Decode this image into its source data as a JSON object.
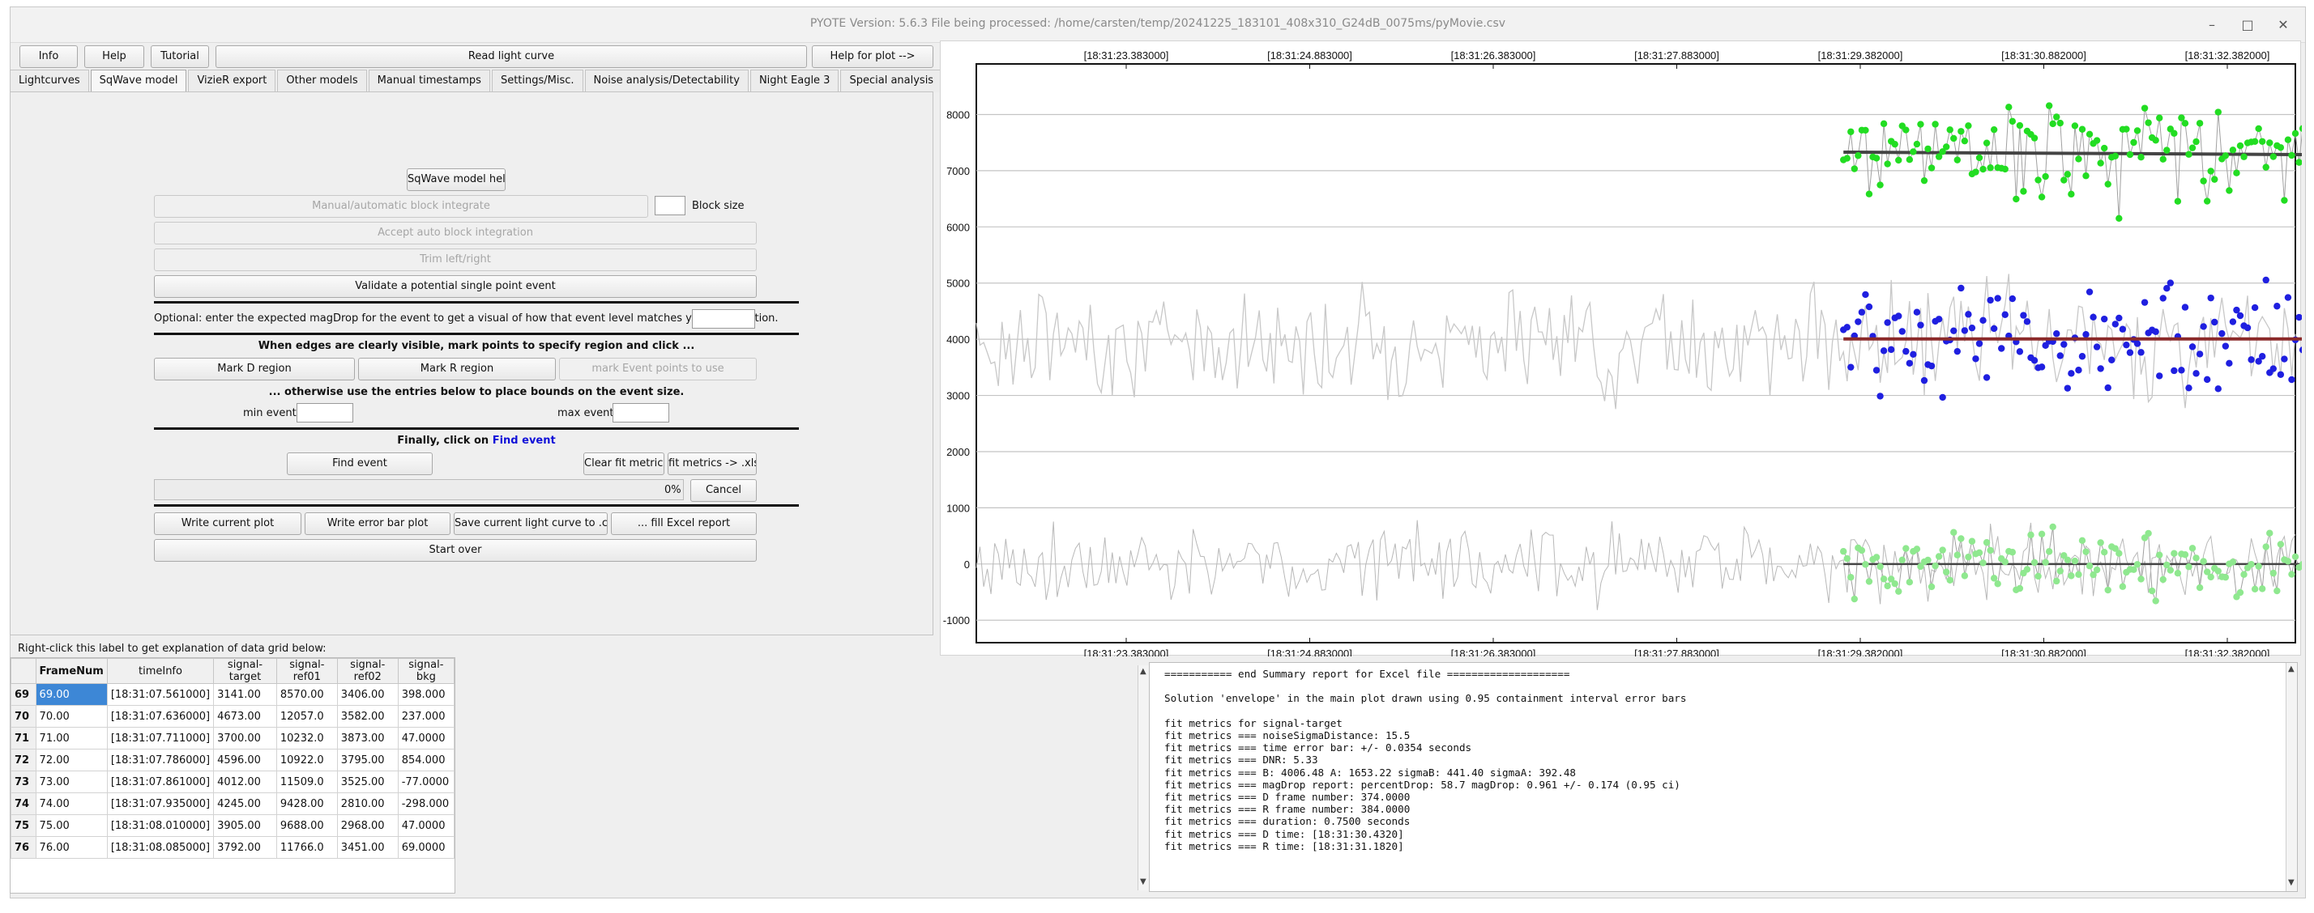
{
  "window": {
    "title": "PYOTE Version: 5.6.3  File being processed: /home/carsten/temp/20241225_183101_408x310_G24dB_0075ms/pyMovie.csv",
    "controls": [
      "minimize",
      "maximize",
      "close"
    ]
  },
  "toolbar": {
    "info": "Info",
    "help": "Help",
    "tutorial": "Tutorial",
    "read_light_curve": "Read light curve",
    "help_for_plot": "Help for plot -->"
  },
  "tabs": [
    "Lightcurves",
    "SqWave model",
    "VizieR export",
    "Other models",
    "Manual timestamps",
    "Settings/Misc.",
    "Noise analysis/Detectability",
    "Night Eagle 3",
    "Special analysis"
  ],
  "sqwave": {
    "model_help": "SqWave model help",
    "block_integrate": "Manual/automatic block integrate",
    "block_size_label": "Block size",
    "accept_auto": "Accept auto block integration",
    "trim": "Trim left/right",
    "validate": "Validate a potential single point event",
    "optional_text": "Optional: enter the expected magDrop for the event to get a visual of how that event level matches your observation.",
    "edges_text": "When edges are clearly visible, mark points to specify region and click ...",
    "mark_d": "Mark D region",
    "mark_r": "Mark R region",
    "mark_event": "mark Event points to use",
    "otherwise_text": "... otherwise use the entries below to place bounds on the event size.",
    "min_event": "min event:",
    "max_event": "max event:",
    "finally_prefix": "Finally, click on",
    "finally_link": "Find event",
    "find_event": "Find event",
    "clear_fit": "Clear fit metrics",
    "fit_xlsx": "fit metrics -> .xlsx",
    "progress": "0%",
    "cancel": "Cancel",
    "write_plot": "Write current plot",
    "write_error_bar": "Write error bar plot",
    "save_csv": "Save current light curve to .csv",
    "fill_excel": "... fill Excel report",
    "start_over": "Start over"
  },
  "grid_label": "Right-click this label to get explanation of data grid below:",
  "grid": {
    "columns": [
      "FrameNum",
      "timeInfo",
      "signal-target",
      "signal-ref01",
      "signal-ref02",
      "signal-bkg"
    ],
    "rows": [
      {
        "rownum": "69",
        "cells": [
          "69.00",
          "[18:31:07.561000]",
          "3141.00",
          "8570.00",
          "3406.00",
          "398.000"
        ]
      },
      {
        "rownum": "70",
        "cells": [
          "70.00",
          "[18:31:07.636000]",
          "4673.00",
          "12057.0",
          "3582.00",
          "237.000"
        ]
      },
      {
        "rownum": "71",
        "cells": [
          "71.00",
          "[18:31:07.711000]",
          "3700.00",
          "10232.0",
          "3873.00",
          "47.0000"
        ]
      },
      {
        "rownum": "72",
        "cells": [
          "72.00",
          "[18:31:07.786000]",
          "4596.00",
          "10922.0",
          "3795.00",
          "854.000"
        ]
      },
      {
        "rownum": "73",
        "cells": [
          "73.00",
          "[18:31:07.861000]",
          "4012.00",
          "11509.0",
          "3525.00",
          "-77.0000"
        ]
      },
      {
        "rownum": "74",
        "cells": [
          "74.00",
          "[18:31:07.935000]",
          "4245.00",
          "9428.00",
          "2810.00",
          "-298.000"
        ]
      },
      {
        "rownum": "75",
        "cells": [
          "75.00",
          "[18:31:08.010000]",
          "3905.00",
          "9688.00",
          "2968.00",
          "47.0000"
        ]
      },
      {
        "rownum": "76",
        "cells": [
          "76.00",
          "[18:31:08.085000]",
          "3792.00",
          "11766.0",
          "3451.00",
          "69.0000"
        ]
      }
    ]
  },
  "report_lines": [
    "=========== end Summary report for Excel file ====================",
    "",
    "Solution 'envelope' in the main plot drawn using 0.95 containment interval error bars",
    "",
    "fit metrics for signal-target",
    "fit metrics === noiseSigmaDistance: 15.5",
    "fit metrics === time error bar: +/- 0.0354 seconds",
    "fit metrics === DNR: 5.33",
    "fit metrics === B: 4006.48 A: 1653.22 sigmaB: 441.40 sigmaA: 392.48",
    "fit metrics === magDrop report: percentDrop: 58.7 magDrop: 0.961 +/- 0.174 (0.95 ci)",
    "fit metrics === D frame number: 374.0000",
    "fit metrics === R frame number: 384.0000",
    "fit metrics === duration: 0.7500 seconds",
    "fit metrics === D time: [18:31:30.4320]",
    "fit metrics === R time: [18:31:31.1820]"
  ],
  "chart_data": {
    "type": "scatter",
    "x_ticks": [
      "[18:31:23.383000]",
      "[18:31:24.883000]",
      "[18:31:26.383000]",
      "[18:31:27.883000]",
      "[18:31:29.382000]",
      "[18:31:30.882000]",
      "[18:31:32.382000]"
    ],
    "y_ticks": [
      -1000,
      0,
      1000,
      2000,
      3000,
      4000,
      5000,
      6000,
      7000,
      8000
    ],
    "ylim": [
      -1400,
      8900
    ],
    "grid": true,
    "colors": {
      "target": "#1f1fe0",
      "ref01": "#22dd22",
      "ref02": "#8fe88f",
      "bkg": "#c8c8c8",
      "fit": "#8b2a2a",
      "ref_fit": "#444444",
      "d_edge": "#dd2222",
      "r_edge": "#22aa22"
    }
  }
}
